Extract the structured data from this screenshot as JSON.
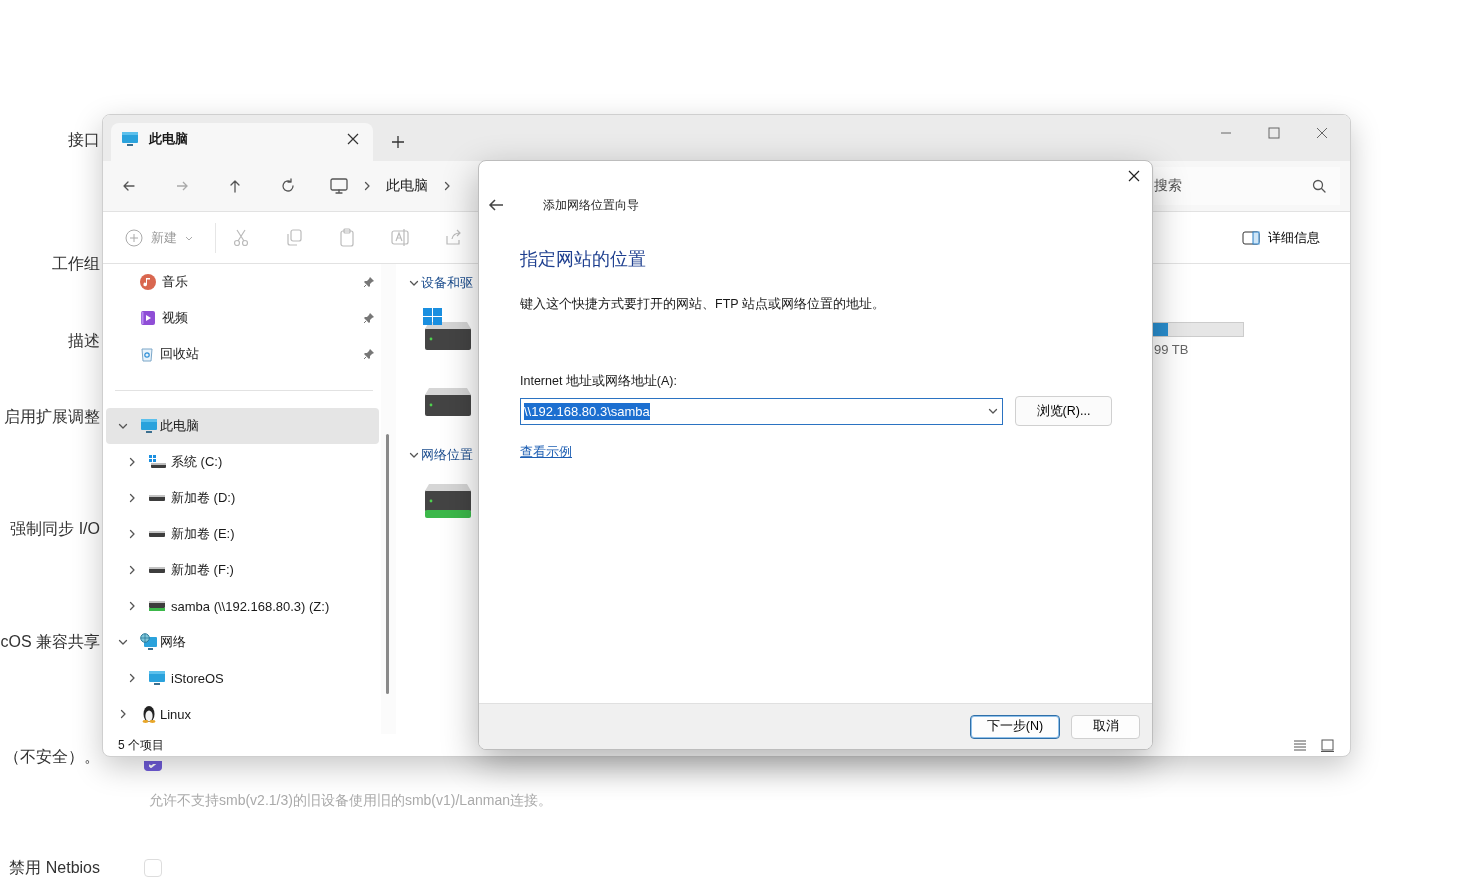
{
  "background": {
    "settings": [
      {
        "kind": "label",
        "label": "接口"
      },
      {
        "kind": "label",
        "label": "工作组"
      },
      {
        "kind": "label",
        "label": "描述"
      },
      {
        "kind": "label",
        "label": "启用扩展调整"
      },
      {
        "kind": "label",
        "label": "强制同步 I/O"
      },
      {
        "kind": "label",
        "label": "cOS 兼容共享"
      },
      {
        "kind": "checkbox",
        "label": "（不安全）。",
        "checked": true,
        "hint": "允许不支持smb(v2.1/3)的旧设备使用旧的smb(v1)/Lanman连接。"
      },
      {
        "kind": "checkbox",
        "label": "禁用 Netbios",
        "checked": false
      }
    ]
  },
  "explorer": {
    "tab": {
      "title": "此电脑"
    },
    "address": {
      "crumbs": [
        "此电脑"
      ]
    },
    "search": {
      "placeholder": "搜索"
    },
    "toolbar": {
      "new_label": "新建",
      "new_disabled": true,
      "details_label": "详细信息"
    },
    "nav": {
      "quick_access": [
        {
          "label": "音乐",
          "kind": "music",
          "pinned": true
        },
        {
          "label": "视频",
          "kind": "video",
          "pinned": true
        },
        {
          "label": "回收站",
          "kind": "recycle",
          "pinned": true
        }
      ],
      "tree": [
        {
          "label": "此电脑",
          "kind": "pc",
          "expanded": true,
          "selected": true,
          "children": [
            {
              "label": "系统 (C:)",
              "kind": "os-drive",
              "expanded": false,
              "selected": false
            },
            {
              "label": "新加卷 (D:)",
              "kind": "drive",
              "expanded": false,
              "selected": false
            },
            {
              "label": "新加卷 (E:)",
              "kind": "drive",
              "expanded": false,
              "selected": false
            },
            {
              "label": "新加卷 (F:)",
              "kind": "drive",
              "expanded": false,
              "selected": false
            },
            {
              "label": "samba (\\\\192.168.80.3) (Z:)",
              "kind": "network-drive",
              "expanded": false,
              "selected": false
            }
          ]
        },
        {
          "label": "网络",
          "kind": "network",
          "expanded": true,
          "selected": false,
          "children": [
            {
              "label": "iStoreOS",
              "kind": "pc",
              "expanded": false,
              "selected": false
            }
          ]
        },
        {
          "label": "Linux",
          "kind": "linux",
          "expanded": false,
          "selected": false
        }
      ]
    },
    "content": {
      "groups": [
        {
          "title": "设备和驱",
          "expanded": true,
          "items": [
            {
              "kind": "os-drive"
            },
            {
              "kind": "drive"
            }
          ]
        },
        {
          "title": "网络位置",
          "expanded": true,
          "items": [
            {
              "kind": "network-drive"
            }
          ]
        }
      ],
      "storage": {
        "level": 0.17,
        "reading": "99 TB"
      }
    },
    "status_bar": {
      "count": "5 个项目"
    }
  },
  "dialog": {
    "title": "添加网络位置向导",
    "heading": "指定网站的位置",
    "description": "键入这个快捷方式要打开的网站、FTP 站点或网络位置的地址。",
    "field_label": "Internet 地址或网络地址(A):",
    "address_value": "\\\\192.168.80.3\\samba",
    "browse_button": "浏览(R)...",
    "example_link": "查看示例",
    "buttons": [
      {
        "label": "下一步(N)",
        "primary": true
      },
      {
        "label": "取消",
        "primary": false
      }
    ]
  }
}
